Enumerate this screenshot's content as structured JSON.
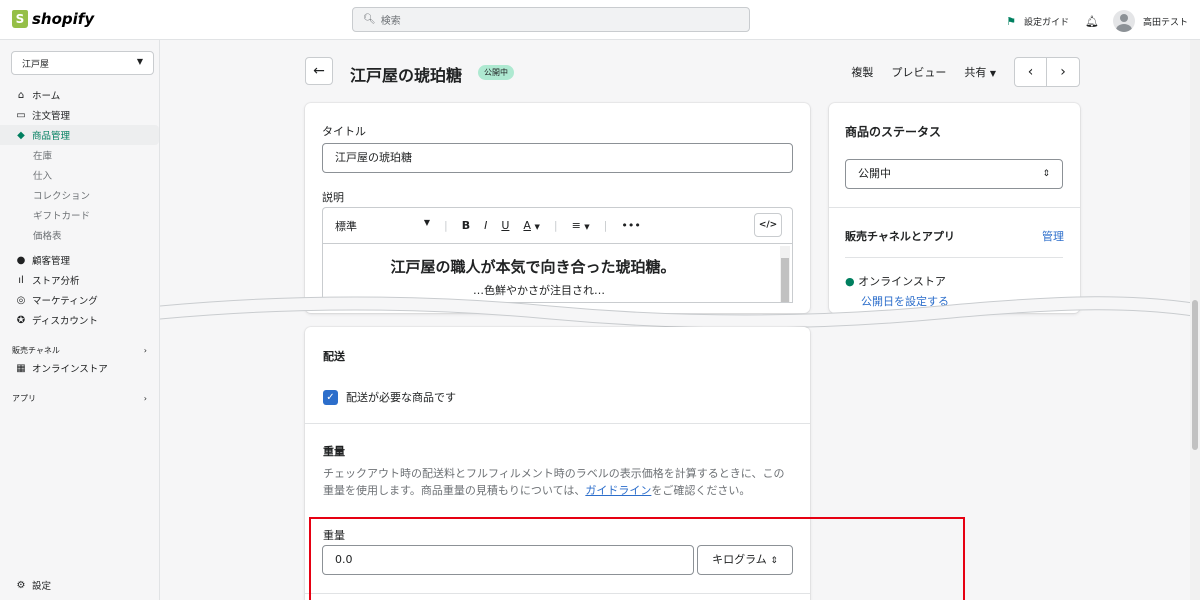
{
  "header": {
    "logo_text": "shopify",
    "logo_letter": "S",
    "search_placeholder": "検索",
    "setup_guide": "設定ガイド",
    "user_name": "高田テスト"
  },
  "sidebar": {
    "store_name": "江戸屋",
    "items": [
      {
        "label": "ホーム",
        "icon": "home-icon"
      },
      {
        "label": "注文管理",
        "icon": "inbox-icon"
      },
      {
        "label": "商品管理",
        "icon": "tag-icon"
      },
      {
        "label": "在庫"
      },
      {
        "label": "仕入"
      },
      {
        "label": "コレクション"
      },
      {
        "label": "ギフトカード"
      },
      {
        "label": "価格表"
      },
      {
        "label": "顧客管理",
        "icon": "person-icon"
      },
      {
        "label": "ストア分析",
        "icon": "bar-chart-icon"
      },
      {
        "label": "マーケティング",
        "icon": "target-icon"
      },
      {
        "label": "ディスカウント",
        "icon": "discount-icon"
      }
    ],
    "sales_channels": "販売チャネル",
    "online_store": "オンラインストア",
    "apps": "アプリ",
    "settings": "設定"
  },
  "page": {
    "title": "江戸屋の琥珀糖",
    "status_badge": "公開中",
    "actions": {
      "duplicate": "複製",
      "preview": "プレビュー",
      "share": "共有"
    }
  },
  "product_card": {
    "title_label": "タイトル",
    "title_value": "江戸屋の琥珀糖",
    "description_label": "説明",
    "toolbar": {
      "format": "標準",
      "bold": "B",
      "italic": "I",
      "underline": "U",
      "color": "A",
      "align": "≡",
      "more": "•••",
      "code": "</>"
    },
    "editor_heading": "江戸屋の職人が本気で向き合った琥珀糖。",
    "editor_partial": "…色鮮やかさが注目され…"
  },
  "status_card": {
    "title": "商品のステータス",
    "status_value": "公開中",
    "channels_title": "販売チャネルとアプリ",
    "manage": "管理",
    "online_store": "オンラインストア",
    "schedule": "公開日を設定する"
  },
  "shipping_card": {
    "title": "配送",
    "checkbox_label": "配送が必要な商品です",
    "checkbox_checked": true,
    "weight_title": "重量",
    "weight_desc_1": "チェックアウト時の配送料とフルフィルメント時のラベルの表示価格を計算するときに、この重量を使用します。商品重量の見積もりについては、",
    "weight_desc_link": "ガイドライン",
    "weight_desc_2": "をご確認ください。",
    "weight_label": "重量",
    "weight_value": "0.0",
    "weight_unit": "キログラム"
  },
  "colors": {
    "accent_green": "#007f5f",
    "link_blue": "#2c6ecb",
    "highlight_red": "#e60012",
    "badge_green": "#aee9d1"
  }
}
